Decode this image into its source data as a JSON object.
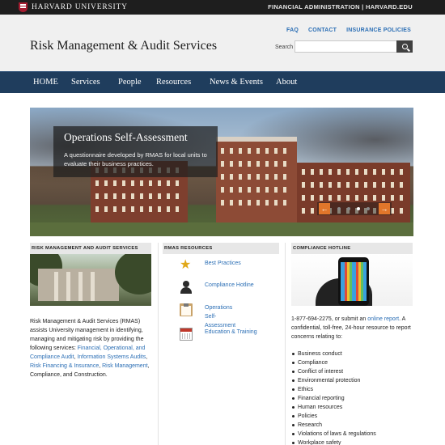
{
  "topbar": {
    "brand": "HARVARD UNIVERSITY",
    "right_text": "FINANCIAL ADMINISTRATION | HARVARD.EDU"
  },
  "header": {
    "util_links": [
      "FAQ",
      "CONTACT",
      "INSURANCE POLICIES"
    ],
    "site_title": "Risk Management & Audit Services",
    "search": {
      "label": "Search",
      "placeholder": ""
    }
  },
  "nav": [
    "HOME",
    "Services",
    "People",
    "Resources",
    "News & Events",
    "About"
  ],
  "hero": {
    "title": "Operations Self-Assessment",
    "text": "A questionnaire developed by RMAS for local units to evaluate their business practices.",
    "prev": "←",
    "next": "→",
    "slide_count": 4,
    "active_slide": 3
  },
  "columns": {
    "left": {
      "heading": "RISK MANAGEMENT AND AUDIT SERVICES",
      "intro": "Risk Management & Audit Services (RMAS) assists University management in identifying, managing and mitigating risk by providing the following services:",
      "link1": "Financial, Operational, and Compliance Audit",
      "sep1": ",",
      "link2": "Information Systems Audits",
      "sep2": ",",
      "link3": "Risk Financing & Insurance",
      "sep3": ",",
      "link4": "Risk Management",
      "tail": ", Compliance, and Construction."
    },
    "middle": {
      "heading": "RMAS RESOURCES",
      "items": [
        {
          "label": "Best Practices",
          "icon": "star-icon"
        },
        {
          "label": "Compliance Hotline",
          "icon": "person-icon"
        },
        {
          "label": "Operations Self-Assessment",
          "icon": "clipboard-icon"
        },
        {
          "label": "Education & Training",
          "icon": "calendar-icon"
        }
      ]
    },
    "right": {
      "heading": "COMPLIANCE HOTLINE",
      "phone_text": "1-877-694-2275, or submit an",
      "link": "online report",
      "rest": ". A confidential, toll-free, 24-hour resource to report concerns relating to:",
      "concerns": [
        "Business conduct",
        "Compliance",
        "Conflict of interest",
        "Environmental protection",
        "Ethics",
        "Financial reporting",
        "Human resources",
        "Policies",
        "Research",
        "Violations of laws & regulations",
        "Workplace safety"
      ]
    }
  },
  "colors": {
    "nav_bg": "#1f3d5d",
    "link": "#2c6fb5",
    "arrow": "#e2762a",
    "harvard_crimson": "#a51c30"
  }
}
